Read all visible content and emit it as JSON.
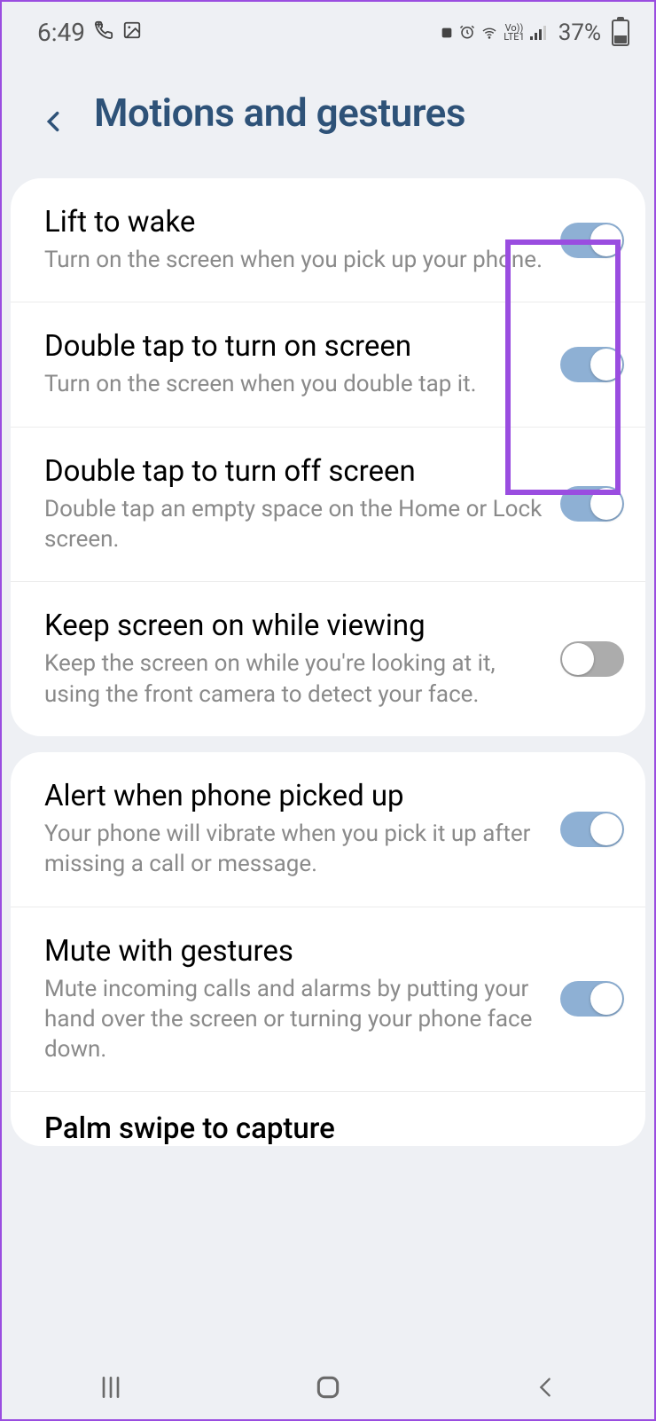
{
  "status_bar": {
    "time": "6:49",
    "battery_pct": "37%",
    "lte_label_top": "Vo))",
    "lte_label_bottom": "LTE1"
  },
  "header": {
    "title": "Motions and gestures"
  },
  "sections": {
    "group1": {
      "lift_to_wake": {
        "title": "Lift to wake",
        "description": "Turn on the screen when you pick up your phone.",
        "enabled": true
      },
      "double_tap_on": {
        "title": "Double tap to turn on screen",
        "description": "Turn on the screen when you double tap it.",
        "enabled": true
      },
      "double_tap_off": {
        "title": "Double tap to turn off screen",
        "description": "Double tap an empty space on the Home or Lock screen.",
        "enabled": true
      },
      "keep_screen_on": {
        "title": "Keep screen on while viewing",
        "description": "Keep the screen on while you're looking at it, using the front camera to detect your face.",
        "enabled": false
      }
    },
    "group2": {
      "alert_picked_up": {
        "title": "Alert when phone picked up",
        "description": "Your phone will vibrate when you pick it up after missing a call or message.",
        "enabled": true
      },
      "mute_gestures": {
        "title": "Mute with gestures",
        "description": "Mute incoming calls and alarms by putting your hand over the screen or turning your phone face down.",
        "enabled": true
      },
      "palm_swipe": {
        "title": "Palm swipe to capture"
      }
    }
  }
}
